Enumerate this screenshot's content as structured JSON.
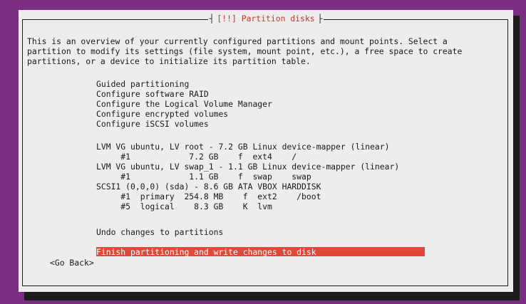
{
  "title": {
    "left_deco": "┤",
    "text": "[!!] Partition disks",
    "right_deco": "├"
  },
  "intro": [
    "This is an overview of your currently configured partitions and mount points. Select a",
    "partition to modify its settings (file system, mount point, etc.), a free space to create",
    "partitions, or a device to initialize its partition table."
  ],
  "menu": [
    "Guided partitioning",
    "Configure software RAID",
    "Configure the Logical Volume Manager",
    "Configure encrypted volumes",
    "Configure iSCSI volumes"
  ],
  "devices": [
    "LVM VG ubuntu, LV root - 7.2 GB Linux device-mapper (linear)",
    "     #1            7.2 GB    f  ext4    /",
    "LVM VG ubuntu, LV swap_1 - 1.1 GB Linux device-mapper (linear)",
    "     #1            1.1 GB    f  swap    swap",
    "SCSI1 (0,0,0) (sda) - 8.6 GB ATA VBOX HARDDISK",
    "     #1  primary  254.8 MB    f  ext2    /boot",
    "     #5  logical    8.3 GB    K  lvm"
  ],
  "actions": {
    "undo": "Undo changes to partitions",
    "finish": "Finish partitioning and write changes to disk"
  },
  "go_back": "<Go Back>",
  "colors": {
    "background": "#7a2f85",
    "dialog": "#ededed",
    "selection": "#e2483a",
    "title_text": "#c0392b"
  }
}
